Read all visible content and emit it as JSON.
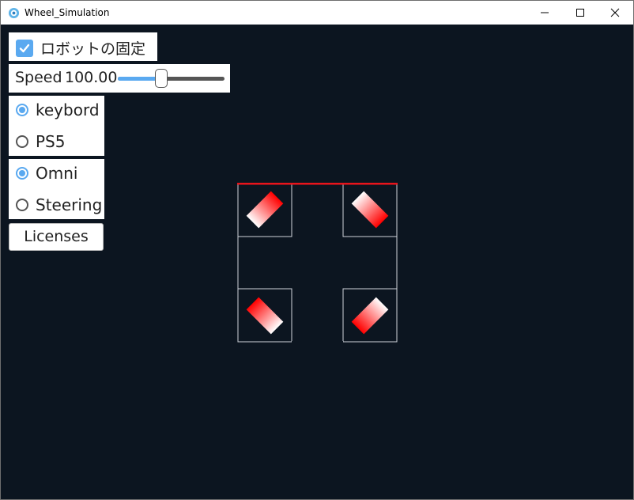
{
  "window": {
    "title": "Wheel_Simulation",
    "minimize_icon": "minimize-icon",
    "maximize_icon": "maximize-icon",
    "close_icon": "close-icon"
  },
  "controls": {
    "fix_robot": {
      "label": "ロボットの固定",
      "checked": true
    },
    "speed": {
      "label": "Speed",
      "value": "100.00",
      "slider_fraction": 0.4
    },
    "input_mode": {
      "options": [
        "keybord",
        "PS5"
      ],
      "selected": "keybord"
    },
    "drive_mode": {
      "options": [
        "Omni",
        "Steering"
      ],
      "selected": "Omni"
    },
    "licenses_button": "Licenses"
  },
  "colors": {
    "background": "#0c1520",
    "accent": "#5aa9f0",
    "robot_front": "#e8141b",
    "wheel_red": "#ff0000",
    "frame_line": "#cfd4da"
  }
}
